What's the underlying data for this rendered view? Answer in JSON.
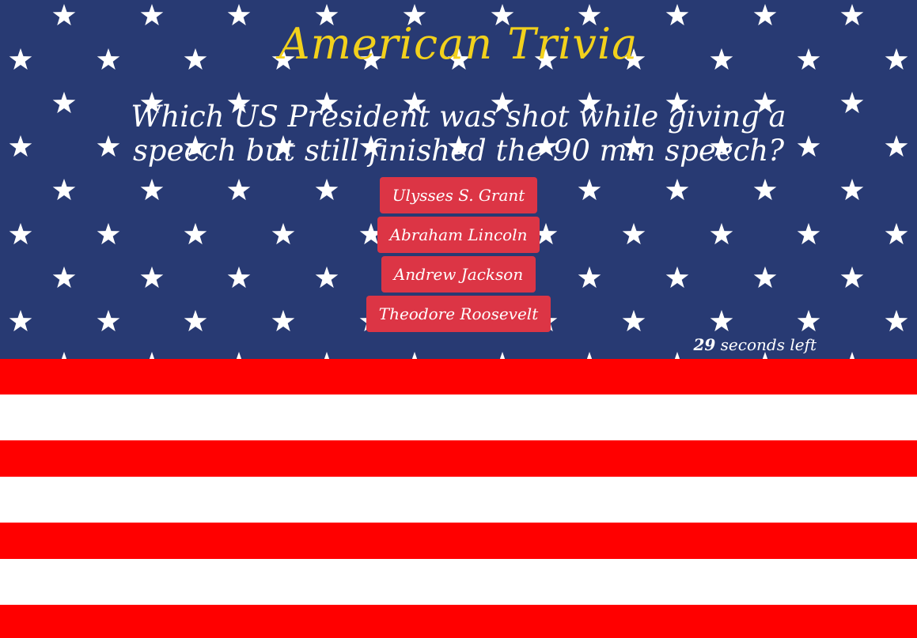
{
  "colors": {
    "star_field": "#283a73",
    "stripe_red": "#ff0000",
    "stripe_white": "#ffffff",
    "title": "#f2d11c",
    "button": "#dc3545"
  },
  "background": {
    "star_icon": "star-icon"
  },
  "game": {
    "title": "American Trivia",
    "question": "Which US President was shot while giving a speech but still finished the 90 min speech?",
    "answers": [
      "Ulysses S. Grant",
      "Abraham Lincoln",
      "Andrew Jackson",
      "Theodore Roosevelt"
    ],
    "timer": {
      "seconds": "29",
      "suffix": "seconds left"
    }
  }
}
